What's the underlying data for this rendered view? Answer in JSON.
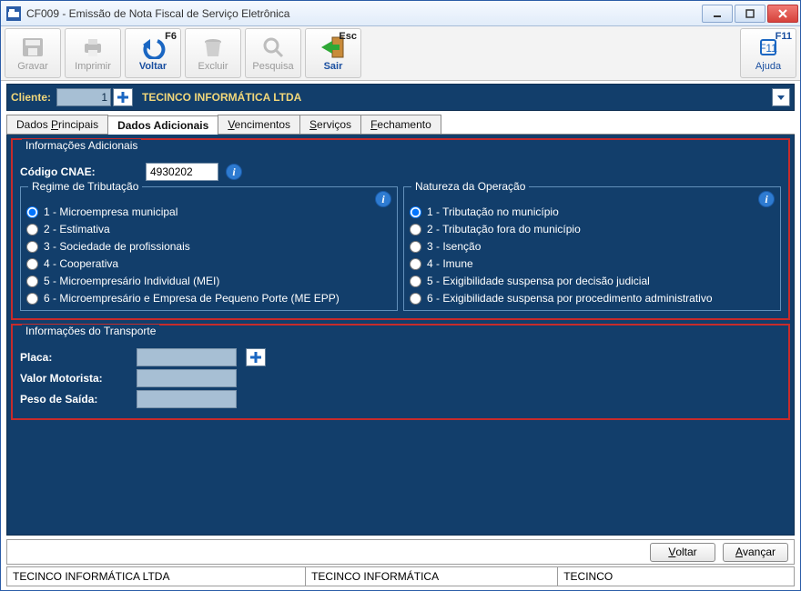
{
  "window": {
    "title": "CF009 - Emissão de Nota Fiscal de Serviço Eletrônica"
  },
  "toolbar": {
    "gravar": {
      "label": "Gravar"
    },
    "imprimir": {
      "label": "Imprimir"
    },
    "voltar": {
      "label": "Voltar",
      "shortcut": "F6"
    },
    "excluir": {
      "label": "Excluir"
    },
    "pesquisa": {
      "label": "Pesquisa"
    },
    "sair": {
      "label": "Sair",
      "shortcut": "Esc"
    },
    "ajuda": {
      "label": "Ajuda",
      "shortcut": "F11"
    }
  },
  "client": {
    "label": "Cliente:",
    "id": "1",
    "name": "TECINCO INFORMÁTICA LTDA"
  },
  "tabs": {
    "t0": "Dados Principais",
    "t1": "Dados Adicionais",
    "t2": "Vencimentos",
    "t3": "Serviços",
    "t4": "Fechamento"
  },
  "info_adicionais": {
    "legend": "Informações Adicionais",
    "cnae_label": "Código CNAE:",
    "cnae_value": "4930202"
  },
  "regime": {
    "legend": "Regime de Tributação",
    "options": {
      "o1": "1 - Microempresa municipal",
      "o2": "2 - Estimativa",
      "o3": "3 - Sociedade de profissionais",
      "o4": "4 - Cooperativa",
      "o5": "5 - Microempresário Individual (MEI)",
      "o6": "6 - Microempresário e Empresa de Pequeno Porte (ME EPP)"
    }
  },
  "natureza": {
    "legend": "Natureza da Operação",
    "options": {
      "o1": "1 - Tributação no município",
      "o2": "2 - Tributação fora do município",
      "o3": "3 - Isenção",
      "o4": "4 - Imune",
      "o5": "5 - Exigibilidade suspensa por decisão judicial",
      "o6": "6 - Exigibilidade suspensa por procedimento administrativo"
    }
  },
  "transporte": {
    "legend": "Informações do Transporte",
    "placa_label": "Placa:",
    "valor_label": "Valor Motorista:",
    "peso_label": "Peso de Saída:"
  },
  "bottom": {
    "voltar": "Voltar",
    "avancar": "Avançar"
  },
  "status": {
    "c1": "TECINCO INFORMÁTICA LTDA",
    "c2": "TECINCO INFORMÁTICA",
    "c3": "TECINCO"
  }
}
